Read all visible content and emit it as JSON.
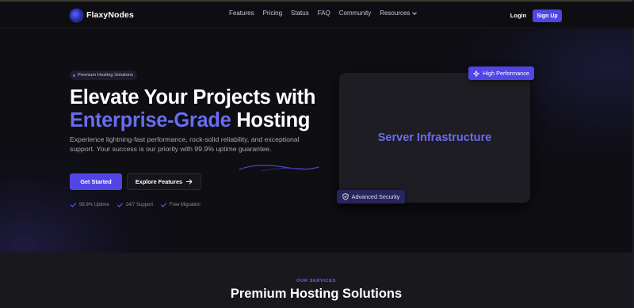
{
  "brand": {
    "name": "FlaxyNodes"
  },
  "nav": {
    "links": [
      "Features",
      "Pricing",
      "Status",
      "FAQ",
      "Community"
    ],
    "dropdown_label": "Resources",
    "login_label": "Login",
    "signup_label": "Sign Up"
  },
  "hero": {
    "badge": "Premium Hosting Solutions",
    "title_line1": "Elevate Your Projects with",
    "title_accent": "Enterprise-Grade",
    "title_rest": " Hosting",
    "description": "Experience lightning-fast performance, rock-solid reliability, and exceptional support. Your success is our priority with 99.9% uptime guarantee.",
    "primary_cta": "Get Started",
    "secondary_cta": "Explore Features",
    "features": [
      "99.9% Uptime",
      "24/7 Support",
      "Free Migration"
    ]
  },
  "media": {
    "placeholder_text": "Server Infrastructure",
    "badge_top": "High Performance",
    "badge_bottom": "Advanced Security"
  },
  "services": {
    "eyebrow": "OUR SERVICES",
    "title": "Premium Hosting Solutions"
  },
  "colors": {
    "accent": "#4f46e5",
    "accent_text": "#6a6cf0",
    "background": "#0e0e13",
    "section_background": "#18181d"
  },
  "icons": {
    "brand_logo": "globe-logo-icon",
    "dropdown": "chevron-down-icon",
    "cta_arrow": "arrow-right-icon",
    "feature_check": "check-icon",
    "performance": "sparkle-icon",
    "security": "shield-check-icon"
  }
}
